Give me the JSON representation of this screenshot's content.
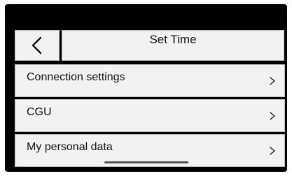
{
  "header": {
    "title": "Set Time",
    "back_icon": "chevron-left-icon"
  },
  "menu": {
    "items": [
      {
        "label": "Connection settings",
        "icon": "chevron-right-icon"
      },
      {
        "label": "CGU",
        "icon": "chevron-right-icon"
      },
      {
        "label": "My personal data",
        "icon": "chevron-right-icon"
      }
    ]
  },
  "colors": {
    "screen_background": "#000000",
    "tile_background": "#f2f2f2",
    "tile_border": "#bdbdbd",
    "text": "#111111",
    "home_indicator": "#555555"
  }
}
